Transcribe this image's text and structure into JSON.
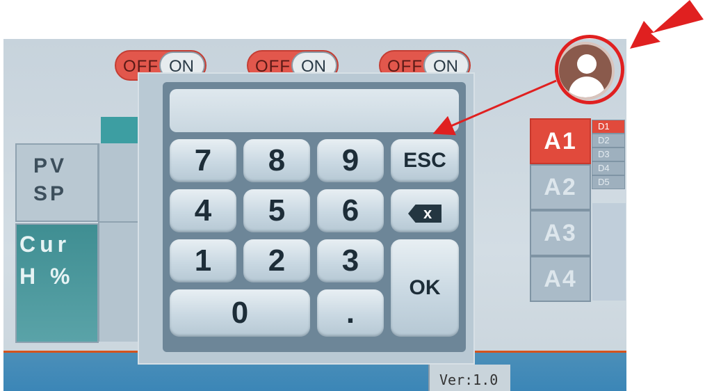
{
  "toggles": [
    {
      "off_label": "OFF",
      "on_label": "ON"
    },
    {
      "off_label": "OFF",
      "on_label": "ON"
    },
    {
      "off_label": "OFF",
      "on_label": "ON"
    }
  ],
  "left_panel": {
    "pv_label": "PV",
    "sp_label": "SP",
    "cur_label": "Cur",
    "h_label": "H %"
  },
  "keypad": {
    "display_value": "",
    "keys": {
      "k7": "7",
      "k8": "8",
      "k9": "9",
      "esc": "ESC",
      "k4": "4",
      "k5": "5",
      "k6": "6",
      "backspace": "x",
      "k1": "1",
      "k2": "2",
      "k3": "3",
      "ok": "OK",
      "k0": "0",
      "dot": "."
    }
  },
  "channels": {
    "a_tabs": [
      "A1",
      "A2",
      "A3",
      "A4"
    ],
    "d_tabs": [
      "D1",
      "D2",
      "D3",
      "D4",
      "D5"
    ],
    "active_a": "A1",
    "active_d": "D1"
  },
  "footer": {
    "version": "Ver:1.0"
  },
  "user": {
    "icon": "user-avatar-icon"
  },
  "colors": {
    "accent_red": "#e14a3c",
    "annotation_red": "#e02020",
    "teal": "#3d9ea2",
    "screen_bg": "#cdd8e0"
  }
}
